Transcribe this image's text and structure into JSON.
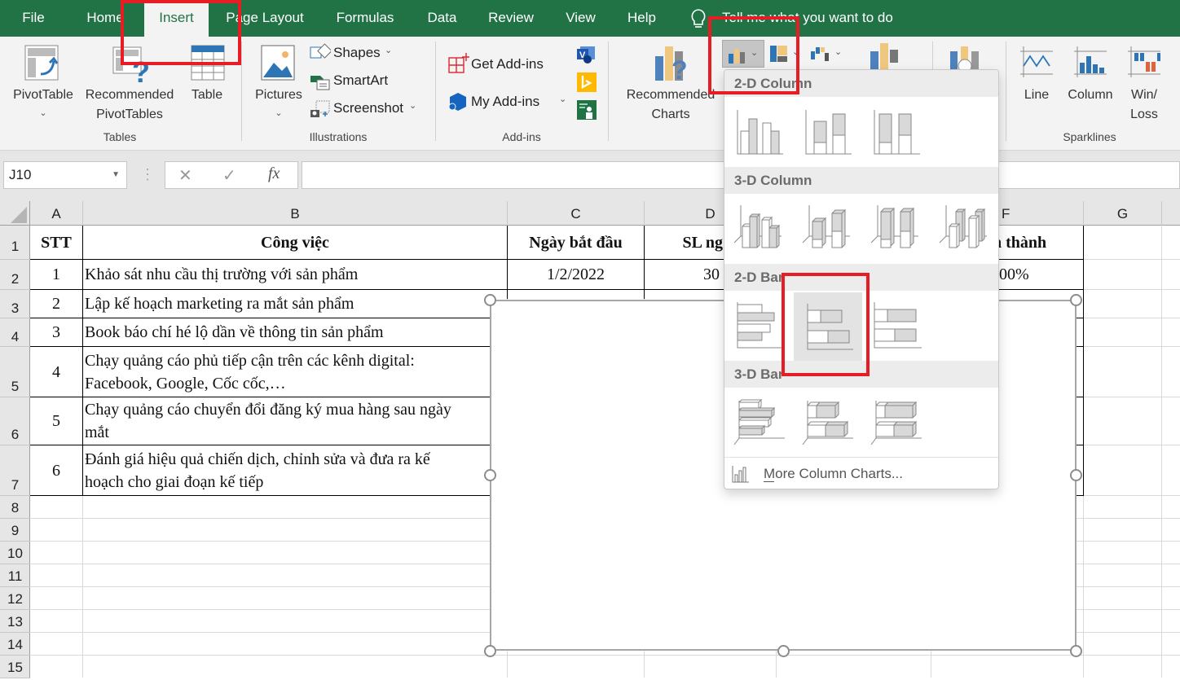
{
  "menu": {
    "tabs": [
      {
        "label": "File"
      },
      {
        "label": "Home"
      },
      {
        "label": "Insert",
        "active": true
      },
      {
        "label": "Page Layout"
      },
      {
        "label": "Formulas"
      },
      {
        "label": "Data"
      },
      {
        "label": "Review"
      },
      {
        "label": "View"
      },
      {
        "label": "Help"
      }
    ],
    "tell_me": "Tell me what you want to do"
  },
  "ribbon": {
    "pivottable": "PivotTable",
    "recommended_pivot_1": "Recommended",
    "recommended_pivot_2": "PivotTables",
    "table": "Table",
    "group_tables": "Tables",
    "pictures": "Pictures",
    "shapes": "Shapes",
    "smartart": "SmartArt",
    "screenshot": "Screenshot",
    "group_illustrations": "Illustrations",
    "get_addins": "Get Add-ins",
    "my_addins": "My Add-ins",
    "group_addins": "Add-ins",
    "recommended_charts_1": "Recommended",
    "recommended_charts_2": "Charts",
    "spark_line": "Line",
    "spark_column": "Column",
    "spark_winloss_1": "Win/",
    "spark_winloss_2": "Loss",
    "group_sparklines": "Sparklines",
    "chevron": "⌄"
  },
  "formula_bar": {
    "name_box": "J10",
    "cancel": "✕",
    "enter": "✓",
    "fx": "fx",
    "formula": ""
  },
  "sheet": {
    "columns": [
      "A",
      "B",
      "C",
      "D",
      "E",
      "F",
      "G"
    ],
    "rows": [
      "1",
      "2",
      "3",
      "4",
      "5",
      "6",
      "7",
      "8",
      "9",
      "10",
      "11",
      "12",
      "13",
      "14",
      "15"
    ],
    "headers": {
      "stt": "STT",
      "cong_viec": "Công việc",
      "ngay_bat_dau": "Ngày bắt đầu",
      "sl_ngay": "SL ng",
      "hoan_thanh": "n thành"
    },
    "data": [
      {
        "stt": "1",
        "task": "Khảo sát nhu cầu thị trường với sản phẩm",
        "start": "1/2/2022",
        "days": "30",
        "pct": "00%"
      },
      {
        "stt": "2",
        "task": "Lập kế hoạch marketing ra mắt sản phẩm"
      },
      {
        "stt": "3",
        "task": "Book báo chí hé lộ dần về thông tin sản phẩm"
      },
      {
        "stt": "4",
        "task_1": "Chạy quảng cáo phủ tiếp cận trên các kênh digital:",
        "task_2": "Facebook, Google, Cốc cốc,…"
      },
      {
        "stt": "5",
        "task_1": "Chạy quảng cáo chuyển đổi đăng ký mua hàng sau ngày",
        "task_2": "mắt"
      },
      {
        "stt": "6",
        "task_1": "Đánh giá hiệu quả chiến dịch, chỉnh sửa và đưa ra kế",
        "task_2": "hoạch cho giai đoạn kế tiếp"
      }
    ]
  },
  "chart_menu": {
    "sections": {
      "col2d": "2-D Column",
      "col3d": "3-D Column",
      "bar2d": "2-D Bar",
      "bar3d": "3-D Bar"
    },
    "more": "More Column Charts...",
    "selected": "Stacked Bar"
  },
  "colors": {
    "excel_green": "#217346",
    "highlight_red": "#e81c24"
  }
}
